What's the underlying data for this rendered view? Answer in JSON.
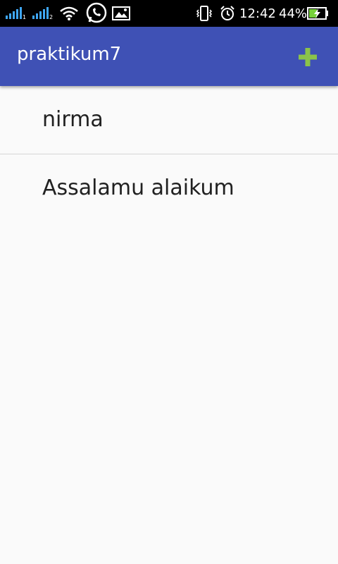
{
  "status_bar": {
    "time": "12:42",
    "battery_percent": "44%",
    "icons": [
      "signal-icon",
      "signal-icon",
      "wifi-icon",
      "whatsapp-icon",
      "gallery-icon",
      "vibrate-icon",
      "alarm-icon",
      "battery-charging-icon"
    ],
    "colors": {
      "signal": "#3fa7f5",
      "battery_fill": "#76d13a"
    }
  },
  "app_bar": {
    "title": "praktikum7",
    "add_icon": "plus-icon",
    "colors": {
      "background": "#3f51b5",
      "add_icon": "#8bc34a"
    }
  },
  "list": {
    "items": [
      {
        "label": "nirma"
      },
      {
        "label": "Assalamu alaikum"
      }
    ]
  }
}
